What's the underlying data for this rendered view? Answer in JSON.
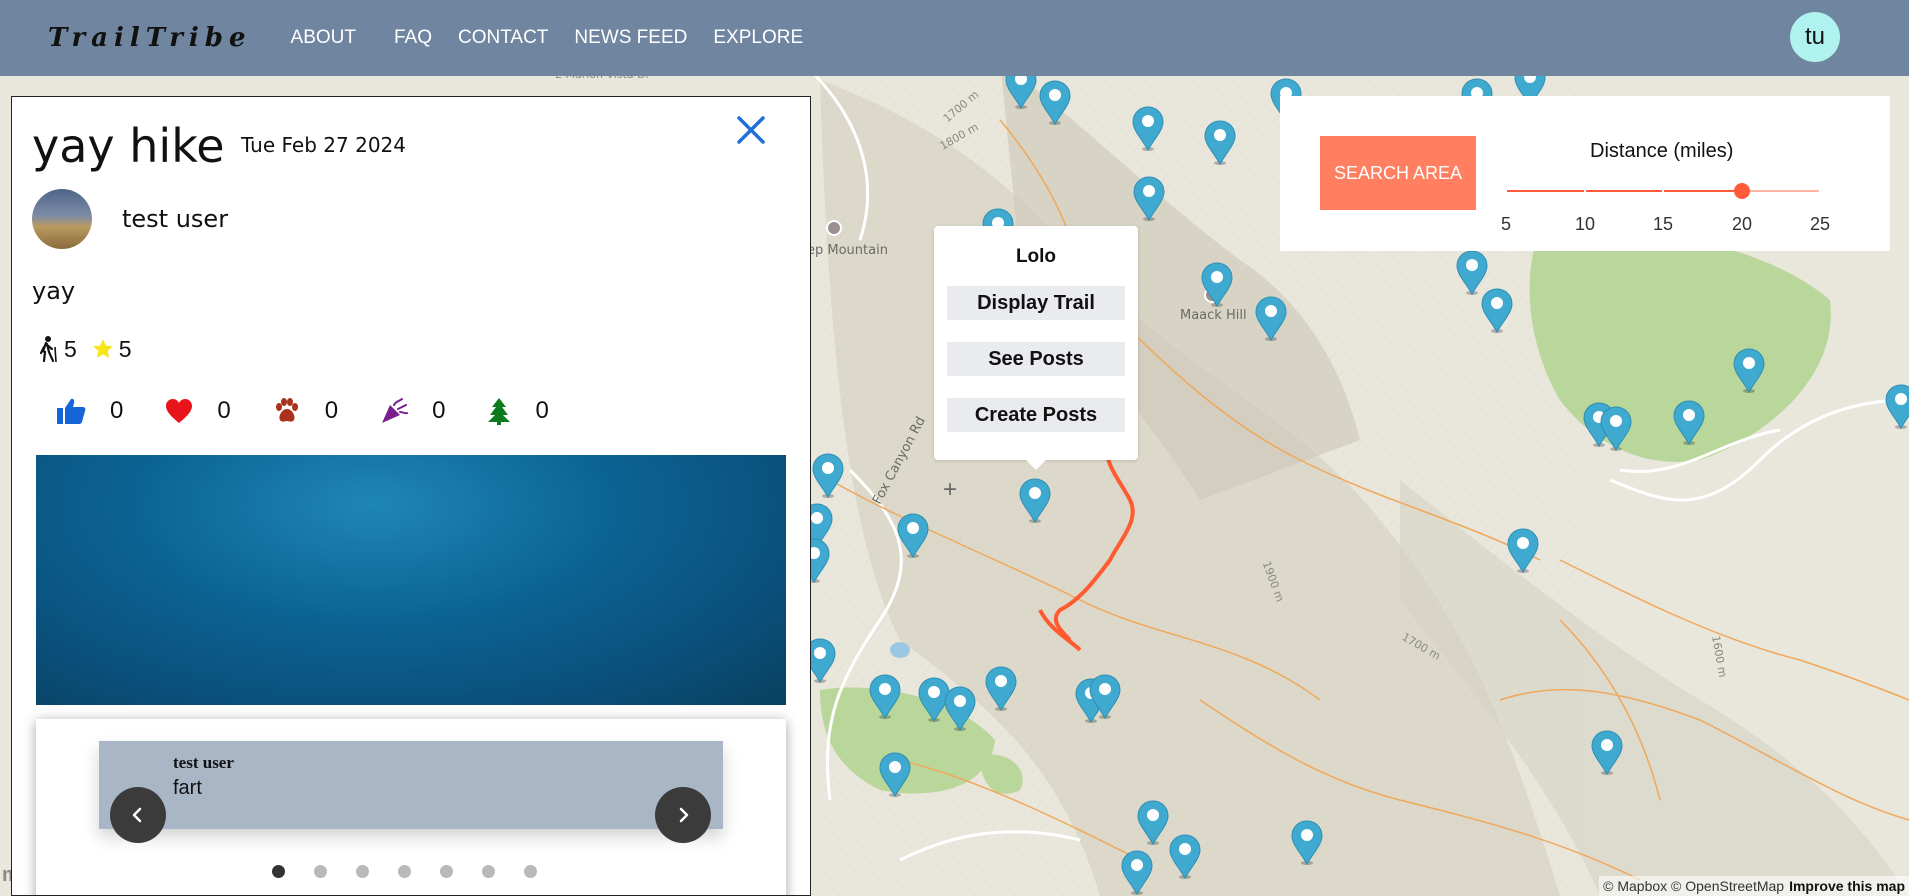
{
  "nav": {
    "brand": "TrailTribe",
    "links": [
      "ABOUT",
      "FAQ",
      "CONTACT",
      "NEWS FEED",
      "EXPLORE"
    ],
    "avatar_initials": "tu",
    "background": "#7086a0"
  },
  "post": {
    "title": "yay hike",
    "date": "Tue Feb 27 2024",
    "author": "test user",
    "body": "yay",
    "difficulty": "5",
    "rating": "5",
    "reactions": [
      {
        "icon": "thumbs-up-icon",
        "count": "0",
        "color": "#1565d8"
      },
      {
        "icon": "heart-icon",
        "count": "0",
        "color": "#e8141c"
      },
      {
        "icon": "paw-icon",
        "count": "0",
        "color": "#a8321c"
      },
      {
        "icon": "party-popper-icon",
        "count": "0",
        "color": "#7a1f8e"
      },
      {
        "icon": "tree-icon",
        "count": "0",
        "color": "#0e7a1e"
      }
    ],
    "comment": {
      "author": "test user",
      "text": "fart"
    },
    "carousel_active_index": 0,
    "carousel_count": 7
  },
  "popup": {
    "trail_name": "Lolo",
    "buttons": [
      "Display Trail",
      "See Posts",
      "Create Posts"
    ]
  },
  "search": {
    "button_label": "SEARCH AREA",
    "distance_label": "Distance (miles)",
    "ticks": [
      "5",
      "10",
      "15",
      "20",
      "25"
    ],
    "min": 5,
    "max": 25,
    "value": 20,
    "accent": "#ff5a3a"
  },
  "map": {
    "labels": {
      "marion": "E Marion Vista Dr",
      "mountain": "ep Mountain",
      "maack": "Maack Hill",
      "fox": "Fox Canyon Rd",
      "elev_1700a": "1700 m",
      "elev_1800": "1800 m",
      "elev_1900": "1900 m",
      "elev_1700b": "1700 m",
      "elev_1600": "1600 m"
    },
    "logo": "mapbox",
    "attribution": "© Mapbox © OpenStreetMap",
    "improve": "Improve this map"
  }
}
